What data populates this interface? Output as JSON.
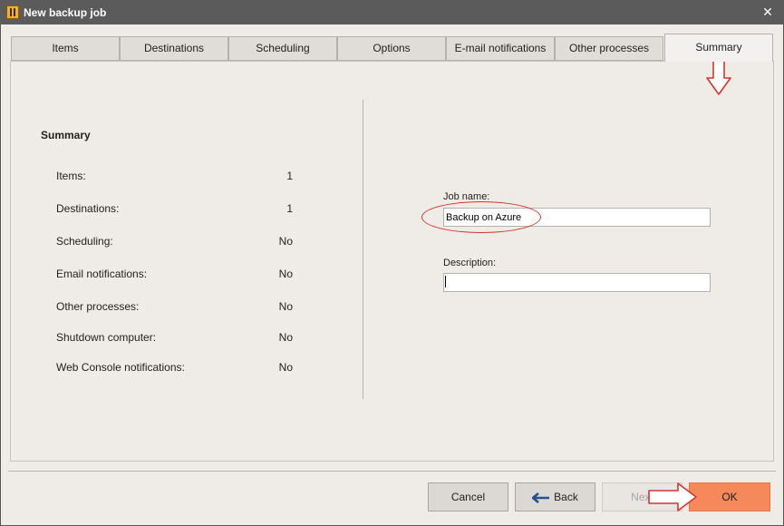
{
  "window": {
    "title": "New backup job",
    "close_glyph": "✕"
  },
  "tabs": [
    {
      "label": "Items"
    },
    {
      "label": "Destinations"
    },
    {
      "label": "Scheduling"
    },
    {
      "label": "Options"
    },
    {
      "label": "E-mail notifications"
    },
    {
      "label": "Other processes"
    },
    {
      "label": "Summary",
      "active": true
    }
  ],
  "summary": {
    "title": "Summary",
    "rows": [
      {
        "label": "Items:",
        "value": "1"
      },
      {
        "label": "Destinations:",
        "value": "1"
      },
      {
        "label": "Scheduling:",
        "value": "No"
      },
      {
        "label": "Email notifications:",
        "value": "No"
      },
      {
        "label": "Other processes:",
        "value": "No"
      },
      {
        "label": "Shutdown computer:",
        "value": "No"
      },
      {
        "label": "Web Console notifications:",
        "value": "No"
      }
    ]
  },
  "form": {
    "job_name_label": "Job name:",
    "job_name_value": "Backup on Azure",
    "description_label": "Description:",
    "description_value": ""
  },
  "buttons": {
    "cancel": "Cancel",
    "back": "Back",
    "next": "Next",
    "ok": "OK"
  },
  "colors": {
    "ok_button": "#f5895c",
    "annotation": "#d9342b",
    "titlebar": "#5b5b5b"
  },
  "icons": {
    "app": "app-logo-icon",
    "close": "close-icon",
    "back": "back-arrow-icon"
  }
}
